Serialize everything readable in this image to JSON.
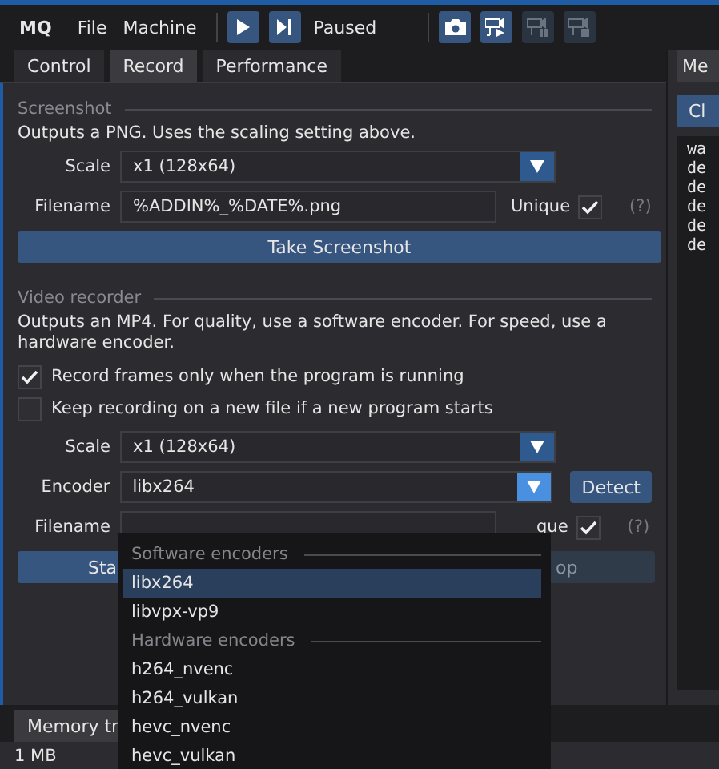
{
  "menubar": {
    "app": "MQ",
    "menus": [
      "File",
      "Machine"
    ],
    "run_controls": [
      {
        "kind": "play"
      },
      {
        "kind": "step"
      }
    ],
    "status": "Paused",
    "record_tools": [
      {
        "kind": "camera",
        "enabled": true
      },
      {
        "kind": "record",
        "enabled": true
      },
      {
        "kind": "pause",
        "enabled": false
      },
      {
        "kind": "stop",
        "enabled": false
      }
    ]
  },
  "tabs": [
    {
      "label": "Control",
      "selected": false
    },
    {
      "label": "Record",
      "selected": true
    },
    {
      "label": "Performance",
      "selected": false
    }
  ],
  "screenshot": {
    "heading": "Screenshot",
    "description": "Outputs a PNG. Uses the scaling setting above.",
    "scale_label": "Scale",
    "scale": "x1 (128x64)",
    "filename_label": "Filename",
    "filename": "%ADDIN%_%DATE%.png",
    "unique_label": "Unique",
    "unique": true,
    "help": "(?)",
    "button": "Take Screenshot"
  },
  "video": {
    "heading": "Video recorder",
    "description": "Outputs an MP4. For quality, use a software encoder. For speed, use a hardware encoder.",
    "options": [
      {
        "label": "Record frames only when the program is running",
        "checked": true
      },
      {
        "label": "Keep recording on a new file if a new program starts",
        "checked": false
      }
    ],
    "scale_label": "Scale",
    "scale": "x1 (128x64)",
    "encoder_label": "Encoder",
    "encoder": "libx264",
    "detect": "Detect",
    "filename_label": "Filename",
    "unique_label": "que",
    "unique": true,
    "help": "(?)",
    "buttons": [
      {
        "label": "Sta",
        "enabled": true
      },
      {
        "label": "op",
        "enabled": false
      }
    ]
  },
  "encoder_dropdown": {
    "items": [
      {
        "kind": "header",
        "label": "Software encoders"
      },
      {
        "kind": "option",
        "label": "libx264",
        "selected": true
      },
      {
        "kind": "option",
        "label": "libvpx-vp9",
        "selected": false
      },
      {
        "kind": "header",
        "label": "Hardware encoders"
      },
      {
        "kind": "option",
        "label": "h264_nvenc",
        "selected": false
      },
      {
        "kind": "option",
        "label": "h264_vulkan",
        "selected": false
      },
      {
        "kind": "option",
        "label": "hevc_nvenc",
        "selected": false
      },
      {
        "kind": "option",
        "label": "hevc_vulkan",
        "selected": false
      }
    ]
  },
  "side_panel": {
    "tab": "Me",
    "button": "Cl",
    "log": [
      "wa",
      "de",
      "de",
      "de",
      "de",
      "de"
    ]
  },
  "bottom_panel": {
    "tabs": [
      {
        "label": "Memory tr",
        "selected": true
      }
    ],
    "status": "1 MB"
  }
}
